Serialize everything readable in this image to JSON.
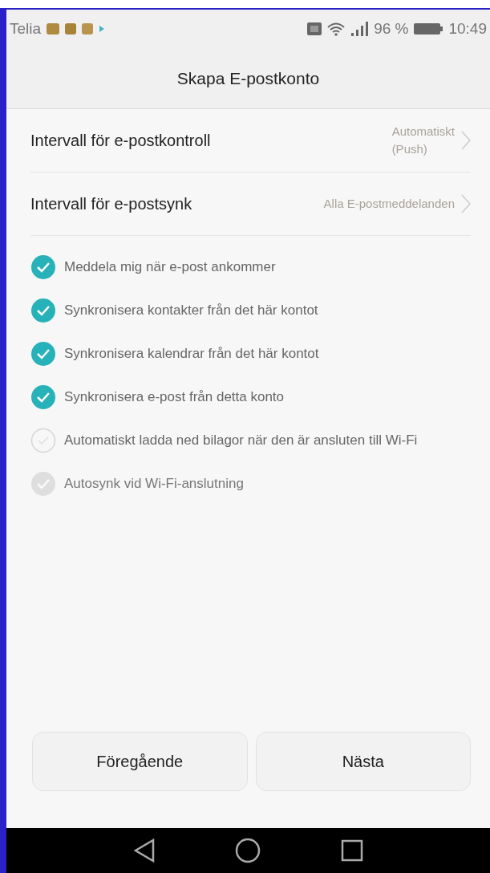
{
  "status_bar": {
    "carrier": "Telia",
    "battery": "96 %",
    "time": "10:49"
  },
  "title": "Skapa E-postkonto",
  "settings": [
    {
      "label": "Intervall för e-postkontroll",
      "value": "Automatiskt\n(Push)"
    },
    {
      "label": "Intervall för e-postsynk",
      "value": "Alla E-postmeddelanden"
    }
  ],
  "options": [
    {
      "label": "Meddela mig när e-post ankommer",
      "checked": true,
      "disabled": false
    },
    {
      "label": "Synkronisera kontakter från det här kontot",
      "checked": true,
      "disabled": false
    },
    {
      "label": "Synkronisera kalendrar från det här kontot",
      "checked": true,
      "disabled": false
    },
    {
      "label": "Synkronisera e-post från detta konto",
      "checked": true,
      "disabled": false
    },
    {
      "label": "Automatiskt ladda ned bilagor när den är ansluten till Wi-Fi",
      "checked": false,
      "disabled": false
    },
    {
      "label": "Autosynk vid Wi-Fi-anslutning",
      "checked": true,
      "disabled": true
    }
  ],
  "buttons": [
    "Föregående",
    "Nästa"
  ]
}
